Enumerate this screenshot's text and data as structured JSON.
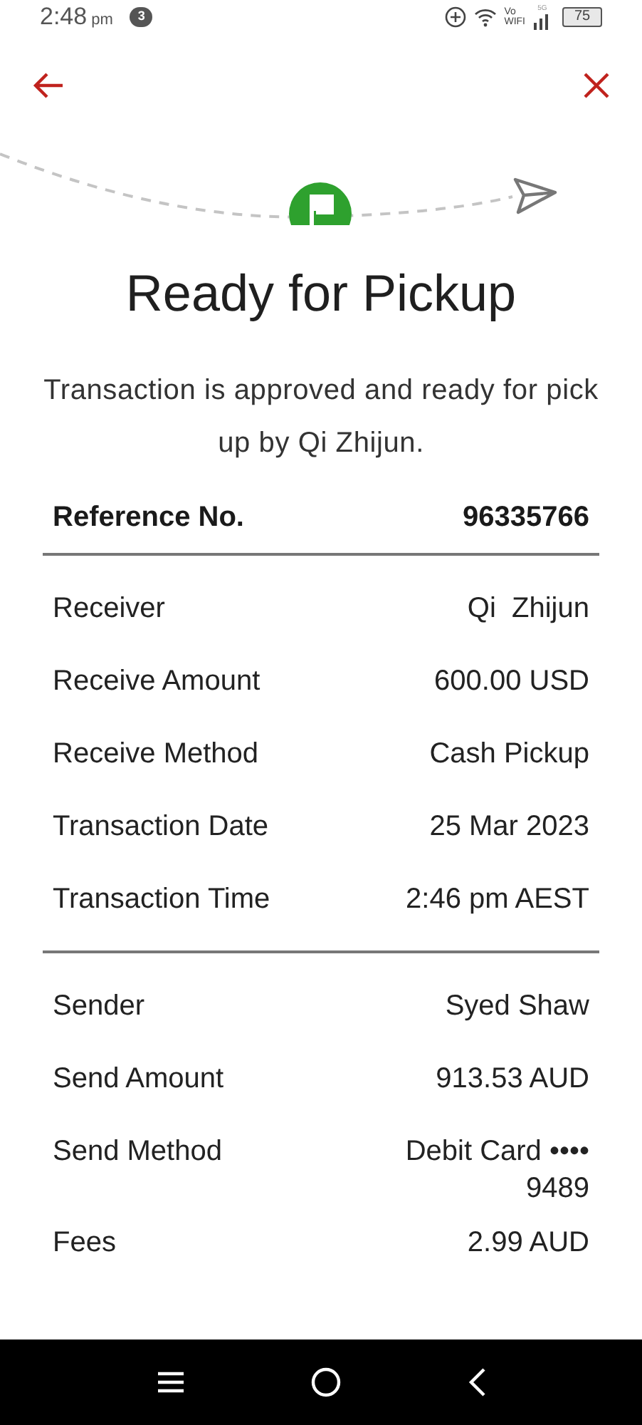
{
  "status_bar": {
    "time": "2:48",
    "ampm": "pm",
    "notification_count": "3",
    "vowifi": "Vo\nWIFI",
    "network": "5G",
    "battery": "75"
  },
  "title": "Ready for Pickup",
  "message": "Transaction is approved and ready for pick up by Qi Zhijun.",
  "reference": {
    "label": "Reference No.",
    "value": "96335766"
  },
  "sections": [
    {
      "rows": [
        {
          "label": "Receiver",
          "value": "Qi  Zhijun"
        },
        {
          "label": "Receive Amount",
          "value": "600.00 USD"
        },
        {
          "label": "Receive Method",
          "value": "Cash Pickup"
        },
        {
          "label": "Transaction Date",
          "value": "25 Mar 2023"
        },
        {
          "label": "Transaction Time",
          "value": "2:46 pm AEST"
        }
      ]
    },
    {
      "rows": [
        {
          "label": "Sender",
          "value": "Syed Shaw"
        },
        {
          "label": "Send Amount",
          "value": "913.53 AUD"
        },
        {
          "label": "Send Method",
          "value": "Debit Card ••••\n9489"
        },
        {
          "label": "Fees",
          "value": "2.99 AUD"
        }
      ]
    }
  ]
}
